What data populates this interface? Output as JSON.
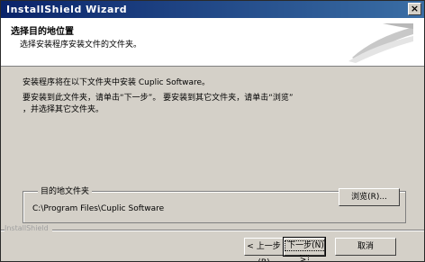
{
  "window": {
    "title": "InstallShield Wizard",
    "close_glyph": "×"
  },
  "header": {
    "title": "选择目的地位置",
    "subtitle": "选择安装程序安装文件的文件夹。"
  },
  "body": {
    "line1": "安装程序将在以下文件夹中安装 Cuplic Software。",
    "line2": "要安装到此文件夹，请单击“下一步”。 要安装到其它文件夹，请单击“浏览”",
    "line3": "，并选择其它文件夹。"
  },
  "destination": {
    "legend": "目的地文件夹",
    "path": "C:\\Program Files\\Cuplic Software",
    "browse_label": "浏览(R)..."
  },
  "footer": {
    "brand": "InstallShield",
    "back_label": "< 上一步(B)",
    "next_label": "下一步(N) >",
    "cancel_label": "取消"
  }
}
